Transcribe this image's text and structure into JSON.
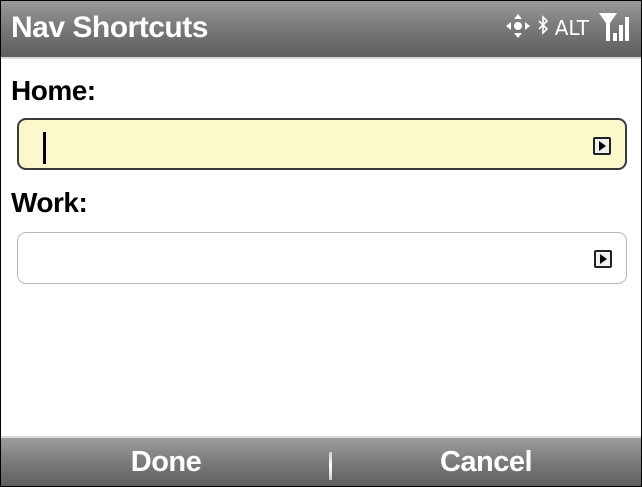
{
  "title_bar": {
    "title": "Nav Shortcuts",
    "status_text": "ALT",
    "icons": [
      "dpad-icon",
      "bluetooth-icon",
      "signal-strength-icon"
    ]
  },
  "form": {
    "home": {
      "label": "Home:",
      "value": "",
      "focused": true
    },
    "work": {
      "label": "Work:",
      "value": "",
      "focused": false
    }
  },
  "softkeys": {
    "left_label": "Done",
    "right_label": "Cancel"
  },
  "colors": {
    "titlebar": "#7a7a7a",
    "focused_field": "#fbf9cc",
    "softkey_bar": "#7b7b7b"
  }
}
